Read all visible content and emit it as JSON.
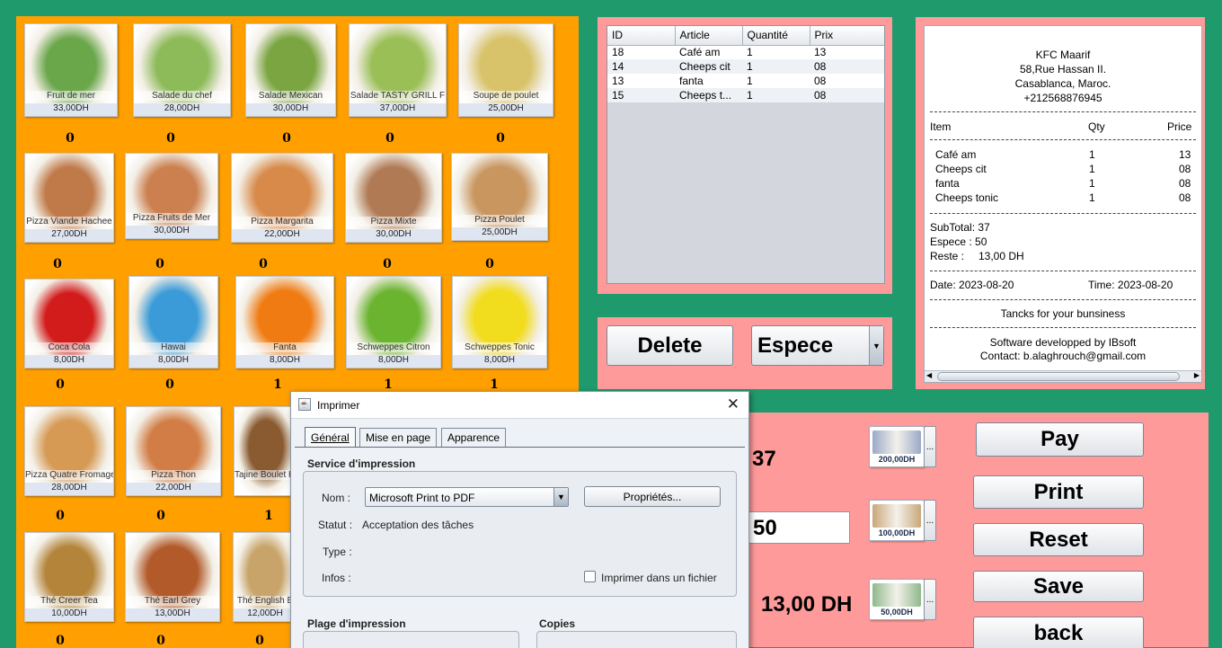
{
  "menu": {
    "items": [
      {
        "label": "Fruit de mer",
        "price": "33,00DH",
        "qty": "0",
        "hue": "#6aa64a"
      },
      {
        "label": "Salade du chef",
        "price": "28,00DH",
        "qty": "0",
        "hue": "#8dbb5a"
      },
      {
        "label": "Salade Mexican",
        "price": "30,00DH",
        "qty": "0",
        "hue": "#7aa540"
      },
      {
        "label": "Salade TASTY GRILL F",
        "price": "37,00DH",
        "qty": "0",
        "hue": "#9abf56"
      },
      {
        "label": "Soupe de poulet",
        "price": "25,00DH",
        "qty": "0",
        "hue": "#d8c36a"
      },
      {
        "label": "Pizza Viande Hachee",
        "price": "27,00DH",
        "qty": "0",
        "hue": "#c07a4a"
      },
      {
        "label": "Pizza Fruits de Mer",
        "price": "30,00DH",
        "qty": "0",
        "hue": "#cc8050"
      },
      {
        "label": "Pizza Margarita",
        "price": "22,00DH",
        "qty": "0",
        "hue": "#d88a4a"
      },
      {
        "label": "Pizza Mixte",
        "price": "30,00DH",
        "qty": "0",
        "hue": "#b07a55"
      },
      {
        "label": "Pizza Poulet",
        "price": "25,00DH",
        "qty": "0",
        "hue": "#c99660"
      },
      {
        "label": "Coca Cola",
        "price": "8,00DH",
        "qty": "0",
        "hue": "#d21b1b"
      },
      {
        "label": "Hawai",
        "price": "8,00DH",
        "qty": "0",
        "hue": "#3b9bd8"
      },
      {
        "label": "Fanta",
        "price": "8,00DH",
        "qty": "1",
        "hue": "#f07b12"
      },
      {
        "label": "Schweppes Citron",
        "price": "8,00DH",
        "qty": "1",
        "hue": "#6bb430"
      },
      {
        "label": "Schweppes Tonic",
        "price": "8,00DH",
        "qty": "1",
        "hue": "#f2dc1e"
      },
      {
        "label": "Pizza Quatre Fromage",
        "price": "28,00DH",
        "qty": "0",
        "hue": "#d69a55"
      },
      {
        "label": "Pizza Thon",
        "price": "22,00DH",
        "qty": "0",
        "hue": "#d27d45"
      },
      {
        "label": "Tajine Boulet Hache",
        "price": "",
        "qty": "1",
        "hue": "#8a5a30"
      },
      {
        "label": "Thé Creer Tea",
        "price": "10,00DH",
        "qty": "0",
        "hue": "#b3843a"
      },
      {
        "label": "Thé Earl Grey",
        "price": "13,00DH",
        "qty": "0",
        "hue": "#b25a2a"
      },
      {
        "label": "Thé English B",
        "price": "12,00DH",
        "qty": "0",
        "hue": "#c8a46a"
      }
    ]
  },
  "order_table": {
    "headers": [
      "ID",
      "Article",
      "Quantité",
      "Prix"
    ],
    "rows": [
      [
        "18",
        "Café am",
        "1",
        "13"
      ],
      [
        "14",
        "Cheeps cit",
        "1",
        "08"
      ],
      [
        "13",
        "fanta",
        "1",
        "08"
      ],
      [
        "15",
        "Cheeps t...",
        "1",
        "08"
      ]
    ]
  },
  "actions": {
    "delete_label": "Delete",
    "payment_method": "Espece"
  },
  "receipt": {
    "shop_name": "KFC Maarif",
    "address1": "58,Rue Hassan II.",
    "address2": "Casablanca, Maroc.",
    "phone": "+212568876945",
    "col_item": "Item",
    "col_qty": "Qty",
    "col_price": "Price",
    "lines": [
      {
        "item": "Café am",
        "qty": "1",
        "price": "13"
      },
      {
        "item": "Cheeps cit",
        "qty": "1",
        "price": "08"
      },
      {
        "item": "fanta",
        "qty": "1",
        "price": "08"
      },
      {
        "item": "Cheeps tonic",
        "qty": "1",
        "price": "08"
      }
    ],
    "subtotal": "SubTotal: 37",
    "espece": "Espece  : 50",
    "reste_label": "Reste   :",
    "reste_value": "13,00 DH",
    "date": "Date: 2023-08-20",
    "time": "Time: 2023-08-20",
    "thanks": "Tancks for your bunsiness",
    "software": "Software developped by IBsoft",
    "contact": "Contact: b.alaghrouch@gmail.com"
  },
  "payment": {
    "total": "37",
    "given": "50",
    "change": "13,00 DH",
    "bills": [
      {
        "label": "200,00DH",
        "color": "#9aa9c8"
      },
      {
        "label": "100,00DH",
        "color": "#c9a77a"
      },
      {
        "label": "50,00DH",
        "color": "#8fb98a"
      }
    ],
    "more_label": "...",
    "pay_label": "Pay",
    "print_label": "Print",
    "reset_label": "Reset",
    "save_label": "Save",
    "back_label": "back"
  },
  "print_dialog": {
    "title": "Imprimer",
    "tabs": [
      "Général",
      "Mise en page",
      "Apparence"
    ],
    "service_heading": "Service d'impression",
    "name_label": "Nom :",
    "printer": "Microsoft Print to PDF",
    "properties_label": "Propriétés...",
    "status_label": "Statut :",
    "status_value": "Acceptation des tâches",
    "type_label": "Type :",
    "info_label": "Infos :",
    "print_to_file_label": "Imprimer dans un fichier",
    "range_heading": "Plage d'impression",
    "copies_heading": "Copies"
  }
}
